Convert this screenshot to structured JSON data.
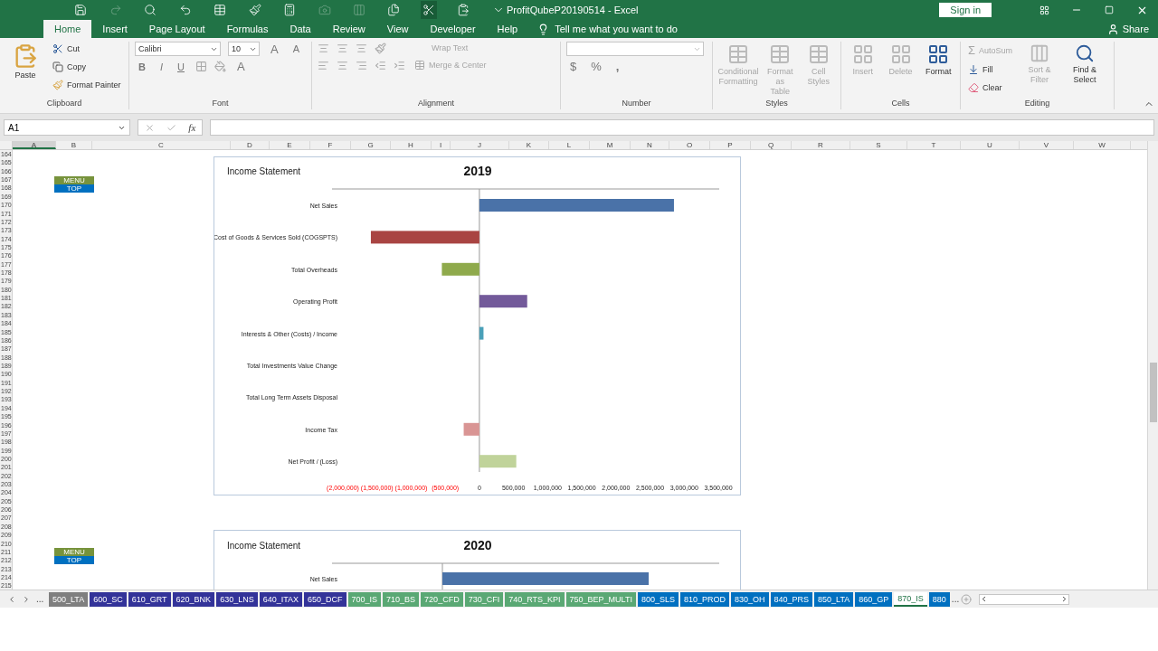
{
  "window": {
    "title": "ProfitQubeP20190514  -  Excel",
    "sign_in": "Sign in",
    "share": "Share"
  },
  "ribbon_tabs": [
    {
      "label": "Home",
      "selected": true
    },
    {
      "label": "Insert",
      "selected": false
    },
    {
      "label": "Page Layout",
      "selected": false
    },
    {
      "label": "Formulas",
      "selected": false
    },
    {
      "label": "Data",
      "selected": false
    },
    {
      "label": "Review",
      "selected": false
    },
    {
      "label": "View",
      "selected": false
    },
    {
      "label": "Developer",
      "selected": false
    },
    {
      "label": "Help",
      "selected": false
    }
  ],
  "tell_me": "Tell me what you want to do",
  "ribbon": {
    "clipboard": {
      "label": "Clipboard",
      "paste": "Paste",
      "cut": "Cut",
      "copy": "Copy",
      "format_painter": "Format Painter"
    },
    "font": {
      "label": "Font",
      "name": "Calibri",
      "size": "10",
      "grow": "A",
      "shrink": "A",
      "bold": "B",
      "italic": "I",
      "underline": "U",
      "font_color": "A"
    },
    "alignment": {
      "label": "Alignment",
      "wrap_text": {
        "label": "Wrap Text",
        "disabled": true
      },
      "merge_center": {
        "label": "Merge & Center",
        "disabled": true
      }
    },
    "number": {
      "label": "Number",
      "currency": "$",
      "percent": "%",
      "comma": ","
    },
    "styles": {
      "label": "Styles",
      "items": [
        {
          "label": "Conditional Formatting",
          "disabled": true
        },
        {
          "label": "Format as Table",
          "disabled": true
        },
        {
          "label": "Cell Styles",
          "disabled": true
        }
      ]
    },
    "cells": {
      "label": "Cells",
      "items": [
        {
          "label": "Insert",
          "disabled": true
        },
        {
          "label": "Delete",
          "disabled": true
        },
        {
          "label": "Format",
          "disabled": false
        }
      ]
    },
    "editing": {
      "label": "Editing",
      "autosum": {
        "label": "AutoSum",
        "symbol": "Σ",
        "disabled": true
      },
      "fill": {
        "label": "Fill",
        "disabled": false
      },
      "clear": {
        "label": "Clear",
        "disabled": false
      },
      "sort": {
        "label": "Sort & Filter",
        "disabled": true
      },
      "find": {
        "label": "Find & Select",
        "disabled": false
      }
    }
  },
  "formula_bar": {
    "name_box": "A1",
    "function_label": "fx"
  },
  "columns": [
    {
      "label": "A",
      "selected": true
    },
    {
      "label": "B",
      "selected": false
    },
    {
      "label": "C",
      "selected": false
    },
    {
      "label": "D",
      "selected": false
    },
    {
      "label": "E",
      "selected": false
    },
    {
      "label": "F",
      "selected": false
    },
    {
      "label": "G",
      "selected": false
    },
    {
      "label": "H",
      "selected": false
    },
    {
      "label": "I",
      "selected": false
    },
    {
      "label": "J",
      "selected": false
    },
    {
      "label": "K",
      "selected": false
    },
    {
      "label": "L",
      "selected": false
    },
    {
      "label": "M",
      "selected": false
    },
    {
      "label": "N",
      "selected": false
    },
    {
      "label": "O",
      "selected": false
    },
    {
      "label": "P",
      "selected": false
    },
    {
      "label": "Q",
      "selected": false
    },
    {
      "label": "R",
      "selected": false
    },
    {
      "label": "S",
      "selected": false
    },
    {
      "label": "T",
      "selected": false
    },
    {
      "label": "U",
      "selected": false
    },
    {
      "label": "V",
      "selected": false
    },
    {
      "label": "W",
      "selected": false
    }
  ],
  "rows": [
    "164",
    "165",
    "166",
    "167",
    "168",
    "169",
    "170",
    "171",
    "172",
    "173",
    "174",
    "175",
    "176",
    "177",
    "178",
    "179",
    "180",
    "181",
    "182",
    "183",
    "184",
    "185",
    "186",
    "187",
    "188",
    "189",
    "190",
    "191",
    "192",
    "193",
    "194",
    "195",
    "196",
    "197",
    "198",
    "199",
    "200",
    "201",
    "202",
    "203",
    "204",
    "205",
    "206",
    "207",
    "208",
    "209",
    "210",
    "211",
    "212",
    "213",
    "214",
    "215"
  ],
  "sheet_buttons": [
    {
      "menu": "MENU",
      "top": "TOP"
    },
    {
      "menu": "MENU",
      "top": "TOP"
    }
  ],
  "charts": [
    {
      "title": "Income Statement",
      "chart_data": {
        "type": "bar",
        "orientation": "horizontal",
        "title": "2019",
        "categories": [
          "Net Sales",
          "Cost of Goods & Services Sold (COGSPTS)",
          "Total Overheads",
          "Operating Profit",
          "Interests & Other (Costs) / Income",
          "Total Investments Value Change",
          "Total Long Term Assets Disposal",
          "Income Tax",
          "Net Profit / (Loss)"
        ],
        "values": [
          2850000,
          -1590000,
          -550000,
          700000,
          60000,
          0,
          0,
          -230000,
          540000
        ],
        "colors": [
          "#4a72a8",
          "#a94442",
          "#8faa4c",
          "#735a9a",
          "#4aa0b8",
          null,
          null,
          "#d99594",
          "#c0d39a"
        ],
        "xlim": [
          -2000000,
          3500000
        ],
        "xticks": [
          {
            "value": -2000000,
            "label": "(2,000,000)"
          },
          {
            "value": -1500000,
            "label": "(1,500,000)"
          },
          {
            "value": -1000000,
            "label": "(1,000,000)"
          },
          {
            "value": -500000,
            "label": "(500,000)"
          },
          {
            "value": 0,
            "label": "0"
          },
          {
            "value": 500000,
            "label": "500,000"
          },
          {
            "value": 1000000,
            "label": "1,000,000"
          },
          {
            "value": 1500000,
            "label": "1,500,000"
          },
          {
            "value": 2000000,
            "label": "2,000,000"
          },
          {
            "value": 2500000,
            "label": "2,500,000"
          },
          {
            "value": 3000000,
            "label": "3,000,000"
          },
          {
            "value": 3500000,
            "label": "3,500,000"
          }
        ]
      }
    }
  ],
  "chart_2020": {
    "title": "Income Statement",
    "year": "2020",
    "label": "Net Sales"
  },
  "sheet_tabs": [
    {
      "label": "500_LTA",
      "color": "#7f7f7f",
      "selected": false
    },
    {
      "label": "600_SC",
      "color": "#333399",
      "selected": false
    },
    {
      "label": "610_GRT",
      "color": "#333399",
      "selected": false
    },
    {
      "label": "620_BNK",
      "color": "#333399",
      "selected": false
    },
    {
      "label": "630_LNS",
      "color": "#333399",
      "selected": false
    },
    {
      "label": "640_ITAX",
      "color": "#333399",
      "selected": false
    },
    {
      "label": "650_DCF",
      "color": "#333399",
      "selected": false
    },
    {
      "label": "700_IS",
      "color": "#5aa874",
      "selected": false
    },
    {
      "label": "710_BS",
      "color": "#5aa874",
      "selected": false
    },
    {
      "label": "720_CFD",
      "color": "#5aa874",
      "selected": false
    },
    {
      "label": "730_CFI",
      "color": "#5aa874",
      "selected": false
    },
    {
      "label": "740_RTS_KPI",
      "color": "#5aa874",
      "selected": false
    },
    {
      "label": "750_BEP_MULTI",
      "color": "#5aa874",
      "selected": false
    },
    {
      "label": "800_SLS",
      "color": "#0070c0",
      "selected": false
    },
    {
      "label": "810_PROD",
      "color": "#0070c0",
      "selected": false
    },
    {
      "label": "830_OH",
      "color": "#0070c0",
      "selected": false
    },
    {
      "label": "840_PRS",
      "color": "#0070c0",
      "selected": false
    },
    {
      "label": "850_LTA",
      "color": "#0070c0",
      "selected": false
    },
    {
      "label": "860_GP",
      "color": "#0070c0",
      "selected": false
    },
    {
      "label": "870_IS",
      "color": "#217346",
      "selected": true
    },
    {
      "label": "880",
      "color": "#0070c0",
      "selected": false
    }
  ],
  "tab_more_left": "...",
  "tab_more_right": "..."
}
